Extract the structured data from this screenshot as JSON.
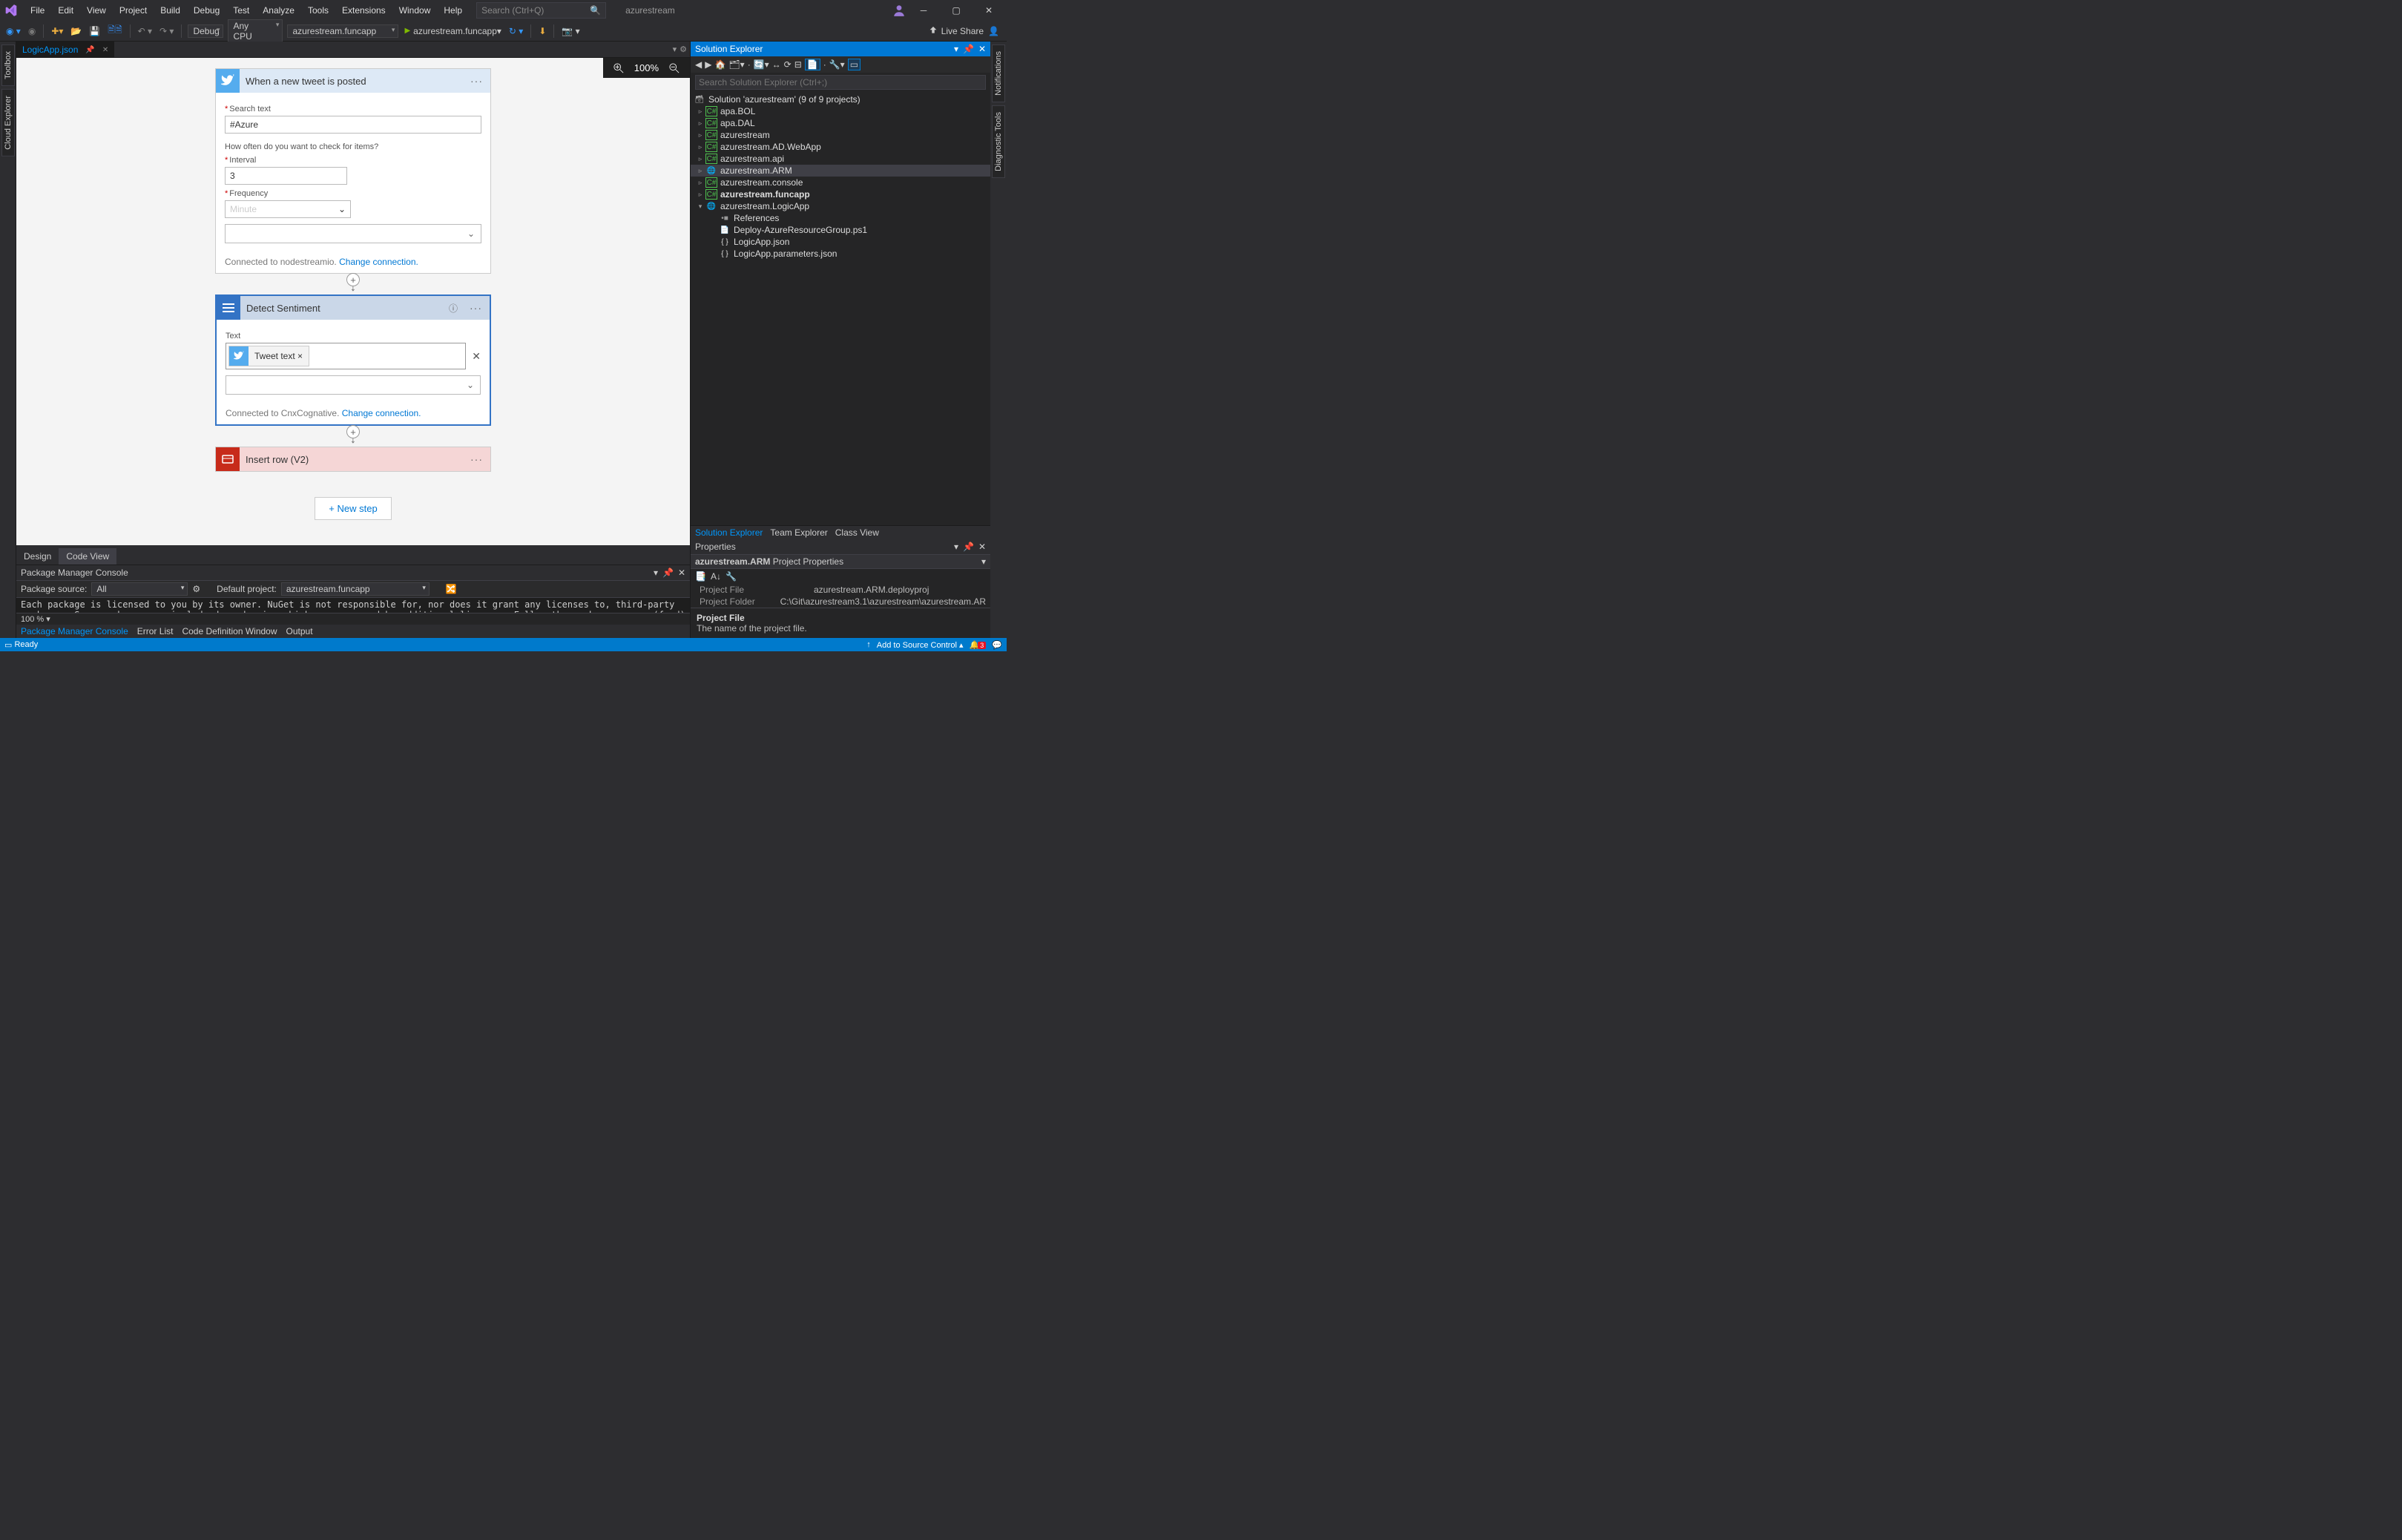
{
  "menu": [
    "File",
    "Edit",
    "View",
    "Project",
    "Build",
    "Debug",
    "Test",
    "Analyze",
    "Tools",
    "Extensions",
    "Window",
    "Help"
  ],
  "search_placeholder": "Search (Ctrl+Q)",
  "solution_title": "azurestream",
  "toolbar": {
    "config": "Debug",
    "platform": "Any CPU",
    "startup": "azurestream.funcapp",
    "run": "azurestream.funcapp",
    "liveshare": "Live Share"
  },
  "doc_tab": "LogicApp.json",
  "zoom": "100%",
  "trigger": {
    "title": "When a new tweet is posted",
    "search_label": "Search text",
    "search_value": "#Azure",
    "freq_q": "How often do you want to check for items?",
    "interval_label": "Interval",
    "interval_value": "3",
    "frequency_label": "Frequency",
    "frequency_value": "Minute",
    "connected": "Connected to nodestreamio. ",
    "change": "Change connection."
  },
  "sentiment": {
    "title": "Detect Sentiment",
    "text_label": "Text",
    "chip": "Tweet text",
    "connected": "Connected to CnxCognative. ",
    "change": "Change connection."
  },
  "insert": {
    "title": "Insert row (V2)"
  },
  "newstep": "+ New step",
  "design_tabs": [
    "Design",
    "Code View"
  ],
  "pmc": {
    "title": "Package Manager Console",
    "src_label": "Package source:",
    "src": "All",
    "proj_label": "Default project:",
    "proj": "azurestream.funcapp",
    "body": "Each package is licensed to you by its owner. NuGet is not responsible for, nor does it grant any licenses to, third-party packages. Some packages may include dependencies which are governed by additional licenses. Follow the package source (feed) URL to determine any dependencies.",
    "scale": "100 %"
  },
  "out_tabs": [
    "Package Manager Console",
    "Error List",
    "Code Definition Window",
    "Output"
  ],
  "se": {
    "title": "Solution Explorer",
    "search": "Search Solution Explorer (Ctrl+;)",
    "sol": "Solution 'azurestream' (9 of 9 projects)",
    "projects": [
      {
        "n": "apa.BOL",
        "t": "cs"
      },
      {
        "n": "apa.DAL",
        "t": "cs"
      },
      {
        "n": "azurestream",
        "t": "cs"
      },
      {
        "n": "azurestream.AD.WebApp",
        "t": "cs"
      },
      {
        "n": "azurestream.api",
        "t": "cs"
      },
      {
        "n": "azurestream.ARM",
        "t": "arm",
        "sel": true,
        "open": true
      },
      {
        "n": "azurestream.console",
        "t": "cs"
      },
      {
        "n": "azurestream.funcapp",
        "t": "cs",
        "bold": true
      },
      {
        "n": "azurestream.LogicApp",
        "t": "arm",
        "open_full": true
      }
    ],
    "logicapp_children": [
      {
        "n": "References",
        "t": "ref"
      },
      {
        "n": "Deploy-AzureResourceGroup.ps1",
        "t": "ps"
      },
      {
        "n": "LogicApp.json",
        "t": "json"
      },
      {
        "n": "LogicApp.parameters.json",
        "t": "json"
      }
    ]
  },
  "re_tabs": [
    "Solution Explorer",
    "Team Explorer",
    "Class View"
  ],
  "props": {
    "title": "Properties",
    "obj_name": "azurestream.ARM",
    "obj_type": "Project Properties",
    "rows": [
      {
        "k": "Project File",
        "v": "azurestream.ARM.deployproj"
      },
      {
        "k": "Project Folder",
        "v": "C:\\Git\\azurestream3.1\\azurestream\\azurestream.AR"
      }
    ],
    "desc_t": "Project File",
    "desc_d": "The name of the project file."
  },
  "left_rail": [
    "Toolbox",
    "Cloud Explorer"
  ],
  "right_rail": [
    "Notifications",
    "Diagnostic Tools"
  ],
  "status": {
    "ready": "Ready",
    "src": "Add to Source Control",
    "bell": "3"
  }
}
